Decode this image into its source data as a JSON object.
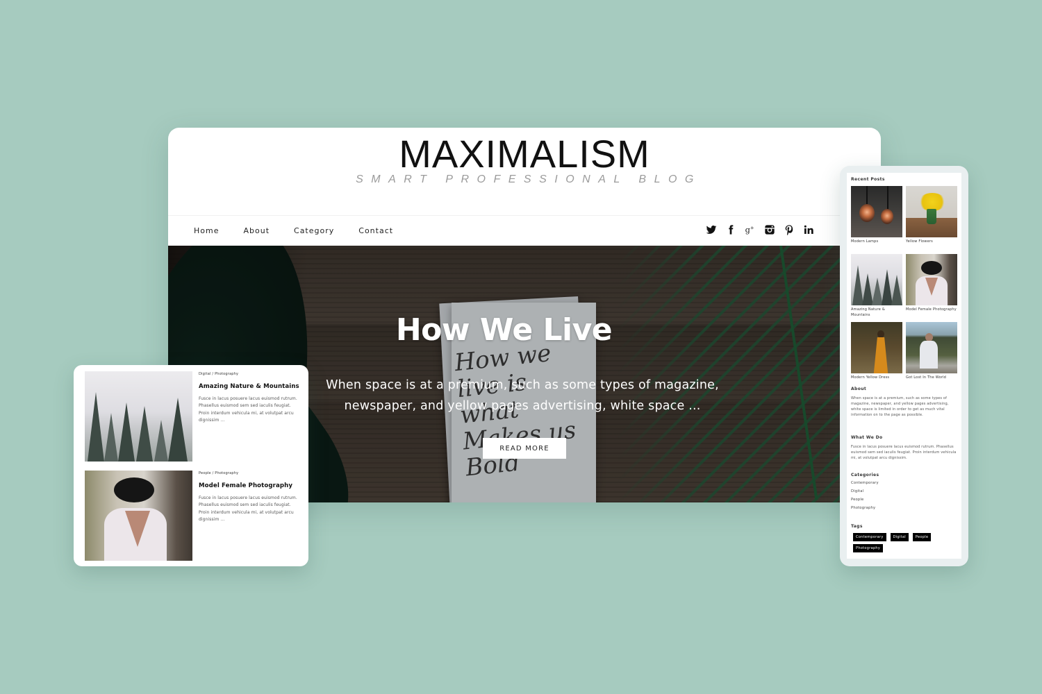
{
  "colors": {
    "background": "#a6cbbf",
    "tag_bg": "#000000",
    "button_bg": "#ffffff"
  },
  "desktop": {
    "brand": {
      "title": "MAXIMALISM",
      "tagline": "SMART PROFESSIONAL BLOG"
    },
    "nav": {
      "links": [
        "Home",
        "About",
        "Category",
        "Contact"
      ]
    },
    "social": [
      {
        "icon": "twitter-icon"
      },
      {
        "icon": "facebook-icon"
      },
      {
        "icon": "google-plus-icon"
      },
      {
        "icon": "instagram-icon"
      },
      {
        "icon": "pinterest-icon"
      },
      {
        "icon": "linkedin-icon"
      }
    ],
    "hero": {
      "title": "How We Live",
      "excerpt": "When space is at a premium, such as some types of magazine, newspaper, and yellow pages advertising, white space ...",
      "button_label": "READ MORE",
      "image_script": "How we live is what Makes us Bold"
    }
  },
  "mobile": {
    "posts": [
      {
        "meta": "Digital / Photography",
        "title": "Amazing Nature & Mountains",
        "excerpt": "Fusce in lacus posuere lacus euismod rutrum. Phasellus euismod sem sed iaculis feugiat. Proin interdum vehicula mi, at volutpat arcu dignissim ..."
      },
      {
        "meta": "People / Photography",
        "title": "Model Female Photography",
        "excerpt": "Fusce in lacus posuere lacus euismod rutrum. Phasellus euismod sem sed iaculis feugiat. Proin interdum vehicula mi, at volutpat arcu dignissim ..."
      }
    ]
  },
  "tablet": {
    "recent_posts": {
      "heading": "Recent Posts",
      "items": [
        {
          "caption": "Modern Lamps"
        },
        {
          "caption": "Yellow Flowers"
        },
        {
          "caption": "Amazing Nature & Mountains"
        },
        {
          "caption": "Model Female Photography"
        },
        {
          "caption": "Modern Yellow Dress"
        },
        {
          "caption": "Got Lost In The World"
        }
      ]
    },
    "about": {
      "heading": "About",
      "text": "When space is at a premium, such as some types of magazine, newspaper, and yellow pages advertising, white space is limited in order to get as much vital information on to the page as possible."
    },
    "what_we_do": {
      "heading": "What We Do",
      "text": "Fusce in lacus posuere lacus euismod rutrum. Phasellus euismod sem sed iaculis feugiat. Proin interdum vehicula mi, at volutpat arcu dignissim."
    },
    "categories": {
      "heading": "Categories",
      "items": [
        "Contemporary",
        "Digital",
        "People",
        "Photography"
      ]
    },
    "tags": {
      "heading": "Tags",
      "items": [
        "Contemporary",
        "Digital",
        "People",
        "Photography"
      ]
    }
  }
}
